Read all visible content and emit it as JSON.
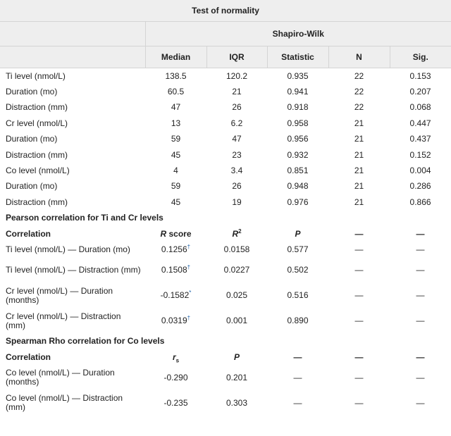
{
  "table": {
    "title": "Test of normality",
    "group_header": "Shapiro-Wilk",
    "columns": [
      "Median",
      "IQR",
      "Statistic",
      "N",
      "Sig."
    ],
    "normality_rows": [
      {
        "label": "Ti level (nmol/L)",
        "median": "138.5",
        "iqr": "120.2",
        "statistic": "0.935",
        "n": "22",
        "sig": "0.153"
      },
      {
        "label": "Duration (mo)",
        "median": "60.5",
        "iqr": "21",
        "statistic": "0.941",
        "n": "22",
        "sig": "0.207"
      },
      {
        "label": "Distraction (mm)",
        "median": "47",
        "iqr": "26",
        "statistic": "0.918",
        "n": "22",
        "sig": "0.068"
      },
      {
        "label": "Cr level (nmol/L)",
        "median": "13",
        "iqr": "6.2",
        "statistic": "0.958",
        "n": "21",
        "sig": "0.447"
      },
      {
        "label": "Duration (mo)",
        "median": "59",
        "iqr": "47",
        "statistic": "0.956",
        "n": "21",
        "sig": "0.437"
      },
      {
        "label": "Distraction (mm)",
        "median": "45",
        "iqr": "23",
        "statistic": "0.932",
        "n": "21",
        "sig": "0.152"
      },
      {
        "label": "Co level (nmol/L)",
        "median": "4",
        "iqr": "3.4",
        "statistic": "0.851",
        "n": "21",
        "sig": "0.004"
      },
      {
        "label": "Duration (mo)",
        "median": "59",
        "iqr": "26",
        "statistic": "0.948",
        "n": "21",
        "sig": "0.286"
      },
      {
        "label": "Distraction (mm)",
        "median": "45",
        "iqr": "19",
        "statistic": "0.976",
        "n": "21",
        "sig": "0.866"
      }
    ],
    "pearson": {
      "heading": "Pearson correlation for Ti and Cr levels",
      "col_label": "Correlation",
      "col_r": "R",
      "col_r_suffix": " score",
      "col_r2": "R",
      "col_r2_sup": "2",
      "col_p": "P",
      "dash": "—",
      "rows": [
        {
          "label": "Ti level (nmol/L) — Duration (mo)",
          "r": "0.1256",
          "mark": "†",
          "r2": "0.0158",
          "p": "0.577",
          "d1": "—",
          "d2": "—"
        },
        {
          "label": "Ti level (nmol/L) — Distraction (mm)",
          "r": "0.1508",
          "mark": "†",
          "r2": "0.0227",
          "p": "0.502",
          "d1": "—",
          "d2": "—"
        },
        {
          "label": "Cr level (nmol/L) — Duration (months)",
          "r": "-0.1582",
          "mark": "*",
          "r2": "0.025",
          "p": "0.516",
          "d1": "—",
          "d2": "—"
        },
        {
          "label": "Cr level (nmol/L) — Distraction (mm)",
          "r": "0.0319",
          "mark": "†",
          "r2": "0.001",
          "p": "0.890",
          "d1": "—",
          "d2": "—"
        }
      ]
    },
    "spearman": {
      "heading": "Spearman Rho correlation for Co levels",
      "col_label": "Correlation",
      "col_r": "r",
      "col_r_sub": "s",
      "col_p": "P",
      "dash": "—",
      "rows": [
        {
          "label": "Co level (nmol/L) — Duration (months)",
          "r": "-0.290",
          "p": "0.201",
          "d1": "—",
          "d2": "—",
          "d3": "—"
        },
        {
          "label": "Co level (nmol/L) — Distraction (mm)",
          "r": "-0.235",
          "p": "0.303",
          "d1": "—",
          "d2": "—",
          "d3": "—"
        }
      ]
    }
  }
}
